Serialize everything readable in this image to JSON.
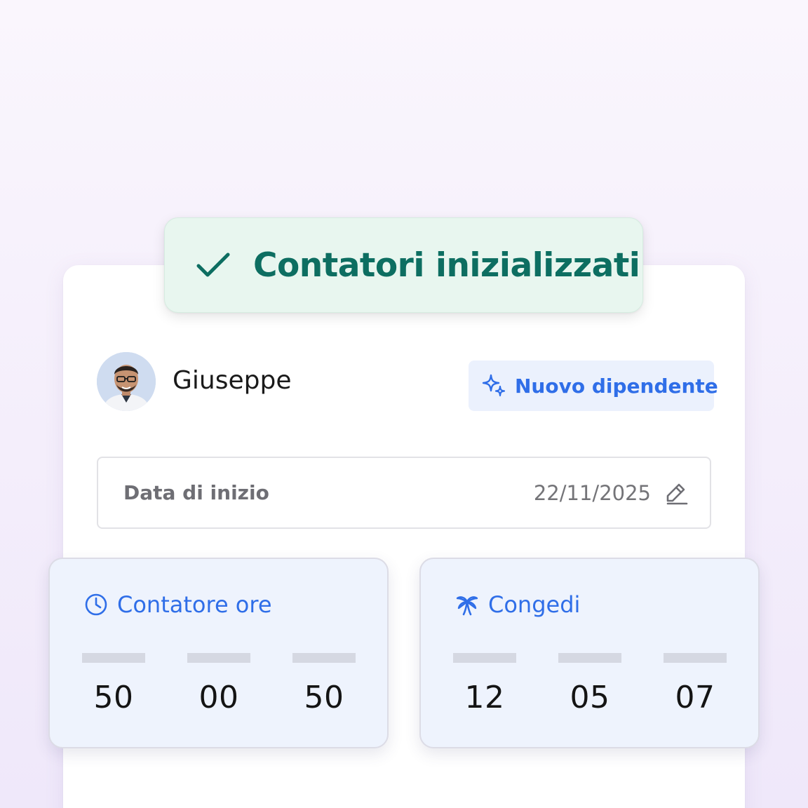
{
  "toast": {
    "message": "Contatori inizializzati",
    "icon": "check-icon",
    "color": "#0d6e61",
    "background": "#e8f6ef"
  },
  "employee": {
    "name": "Giuseppe",
    "avatar": "employee-avatar-photo"
  },
  "badge": {
    "label": "Nuovo dipendente",
    "icon": "sparkles-icon",
    "color": "#2f6ee8",
    "background": "#ebf1fd"
  },
  "start_date": {
    "label": "Data di inizio",
    "value": "22/11/2025",
    "icon": "pencil-icon"
  },
  "hours_counter": {
    "title": "Contatore ore",
    "icon": "clock-icon",
    "values": [
      "50",
      "00",
      "50"
    ]
  },
  "leave_counter": {
    "title": "Congedi",
    "icon": "palm-tree-icon",
    "values": [
      "12",
      "05",
      "07"
    ]
  },
  "accent_color": "#2f6ee8"
}
